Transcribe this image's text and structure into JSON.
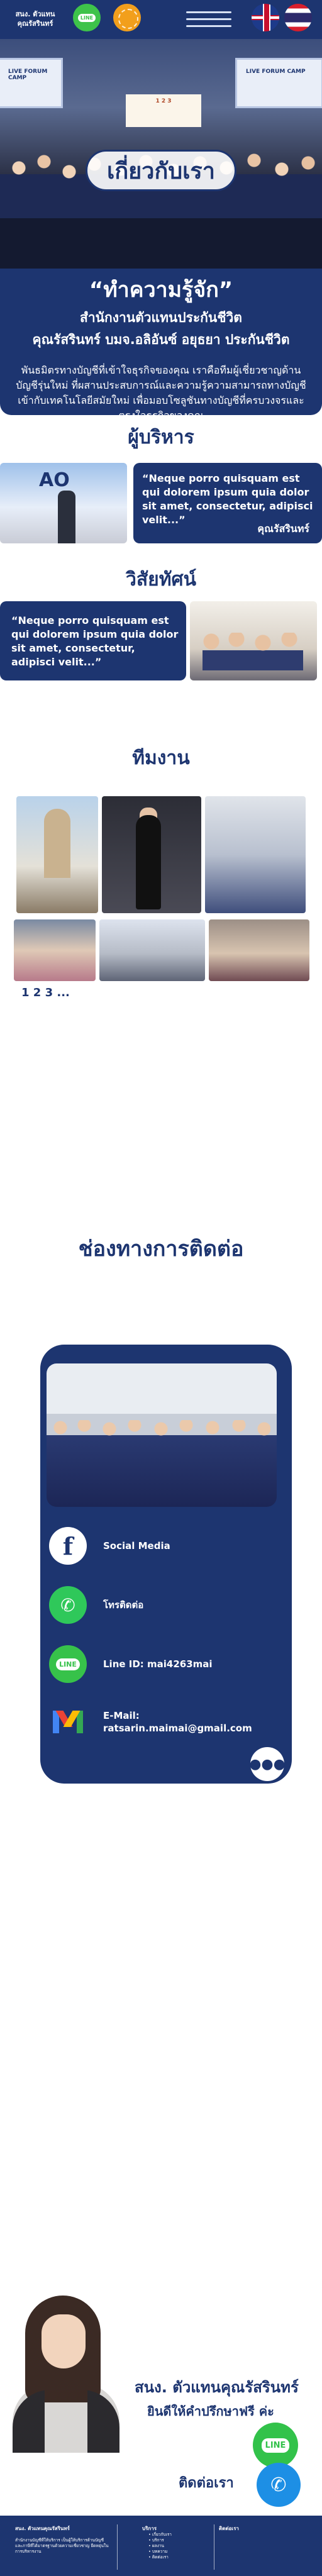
{
  "header": {
    "brand": "สนง. ตัวแทน\nคุณรัสรินทร์",
    "line_badge": "LINE"
  },
  "hero": {
    "banner_left": "LIVE FORUM CAMP",
    "banner_mid": "1 2 3",
    "banner_right": "LIVE FORUM CAMP",
    "about_title": "เกี่ยวกับเรา"
  },
  "intro": {
    "title": "“ทำความรู้จัก”",
    "subtitle": "สำนักงานตัวแทนประกันชีวิต",
    "name": "คุณรัสรินทร์ บมจ.อลิอันซ์ อยุธยา ประกันชีวิต",
    "description": "พันธมิตรทางบัญชีที่เข้าใจธุรกิจของคุณ เราคือทีมผู้เชี่ยวชาญด้านบัญชีรุ่นใหม่ ที่ผสานประสบการณ์และความรู้ความสามารถทางบัญชีเข้ากับเทคโนโลยีสมัยใหม่ เพื่อมอบโซลูชันทางบัญชีที่ครบวงจรและตรงใจธุรกิจของคุณ"
  },
  "management": {
    "title": "ผู้บริหาร",
    "quote": "“Neque porro quisquam est qui dolorem ipsum quia dolor sit amet, consectetur, adipisci velit...”",
    "author": "คุณรัสรินทร์"
  },
  "vision": {
    "title": "วิสัยทัศน์",
    "quote": "“Neque porro quisquam est qui dolorem ipsum quia dolor sit amet, consectetur, adipisci velit...”"
  },
  "team": {
    "title": "ทีมงาน",
    "pager": "1 2 3 ..."
  },
  "contact": {
    "title": "ช่องทางการติดต่อ",
    "items": [
      {
        "label": "Social Media",
        "icon": "facebook-icon"
      },
      {
        "label": "โทรติดต่อ",
        "icon": "phone-icon"
      },
      {
        "label": "Line ID: mai4263mai",
        "icon": "line-icon"
      },
      {
        "label": "E-Mail:\nratsarin.maimai@gmail.com",
        "icon": "gmail-icon"
      }
    ],
    "line_badge": "LINE"
  },
  "promo": {
    "title": "สนง. ตัวแทนคุณรัสรินทร์",
    "subtitle": "ยินดีให้คำปรึกษาฟรี ค่ะ",
    "line_badge": "LINE",
    "contact_label": "ติดต่อเรา"
  },
  "footer": {
    "col1_title": "สนง. ตัวแทนคุณรัสรินทร์",
    "col1_text": "สำนักงานบัญชีที่ให้บริการ เป็นผู้ให้บริการด้านบัญชีและภาษีที่ได้มาตรฐานด้วยความเชี่ยวชาญ ยืดหยุ่นในการบริหารงาน",
    "col2_title": "บริการ",
    "col2_items": [
      "เกี่ยวกับเรา",
      "บริการ",
      "ผลงาน",
      "บทความ",
      "ติดต่อเรา"
    ],
    "col3_title": "ติดต่อเรา",
    "colors": {
      "primary": "#1d3570",
      "line_green": "#37c24a",
      "accent_orange": "#f29f1c"
    }
  }
}
